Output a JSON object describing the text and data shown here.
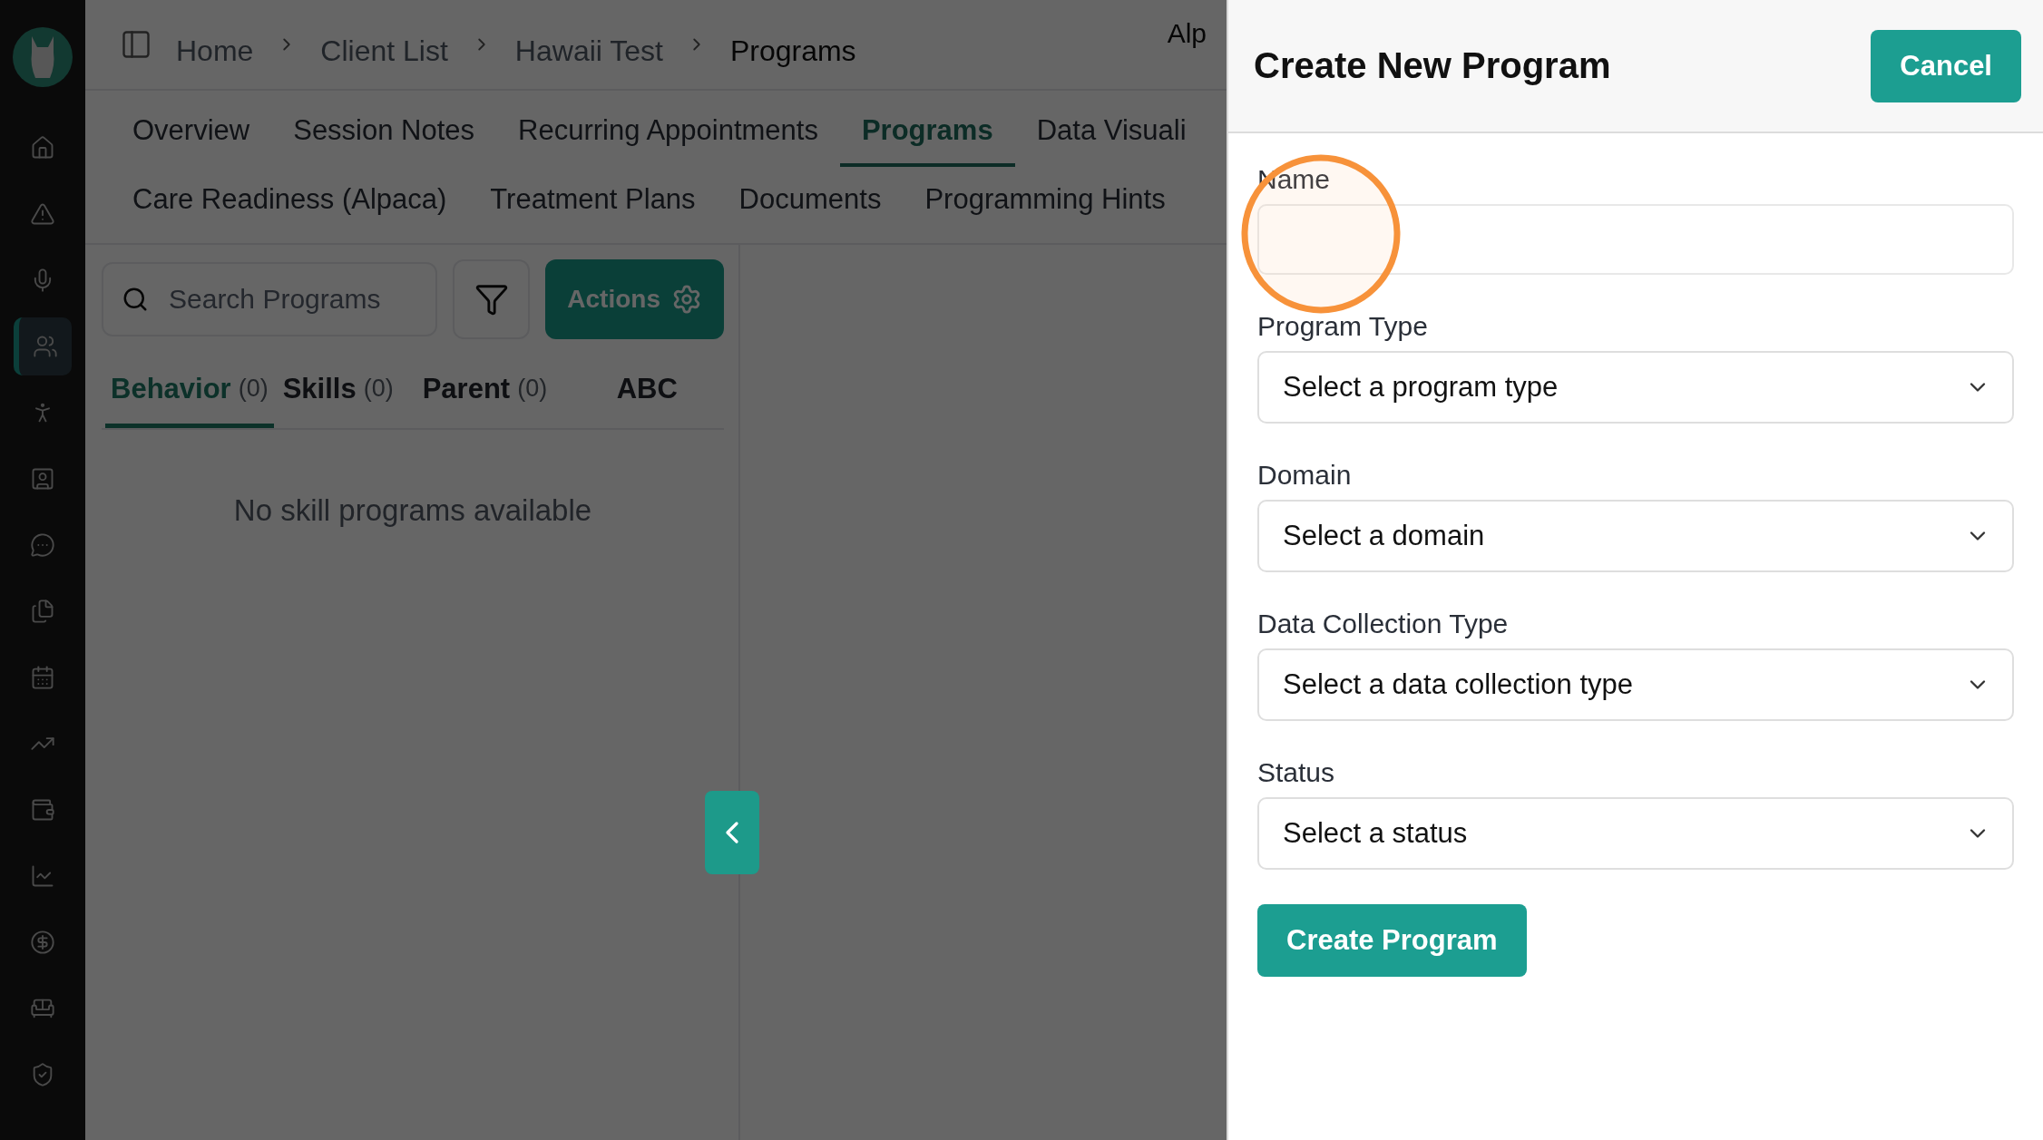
{
  "sidebar": {
    "items": [
      {
        "selected": false
      },
      {
        "selected": false
      },
      {
        "selected": false
      },
      {
        "selected": true
      },
      {
        "selected": false
      },
      {
        "selected": false
      },
      {
        "selected": false
      },
      {
        "selected": false
      },
      {
        "selected": false
      },
      {
        "selected": false
      },
      {
        "selected": false
      },
      {
        "selected": false
      },
      {
        "selected": false
      },
      {
        "selected": false
      },
      {
        "selected": false
      }
    ]
  },
  "breadcrumb": [
    "Home",
    "Client List",
    "Hawaii Test",
    "Programs"
  ],
  "header_text": "Alp",
  "tab_rows": [
    [
      {
        "label": "Overview",
        "selected": false
      },
      {
        "label": "Session Notes",
        "selected": false
      },
      {
        "label": "Recurring Appointments",
        "selected": false
      },
      {
        "label": "Programs",
        "selected": true
      },
      {
        "label": "Data Visuali",
        "selected": false
      }
    ],
    [
      {
        "label": "Care Readiness (Alpaca)",
        "selected": false
      },
      {
        "label": "Treatment Plans",
        "selected": false
      },
      {
        "label": "Documents",
        "selected": false
      },
      {
        "label": "Programming Hints",
        "selected": false
      }
    ]
  ],
  "search": {
    "placeholder": "Search Programs"
  },
  "actions_button": "Actions",
  "program_tabs": [
    {
      "label": "Behavior",
      "count": "(0)",
      "selected": true
    },
    {
      "label": "Skills",
      "count": "(0)",
      "selected": false
    },
    {
      "label": "Parent",
      "count": "(0)",
      "selected": false
    },
    {
      "label": "ABC",
      "selected": false
    }
  ],
  "empty_message": "No skill programs available",
  "drawer": {
    "title": "Create New Program",
    "cancel": "Cancel",
    "fields": [
      {
        "kind": "text",
        "label": "Name"
      },
      {
        "kind": "select",
        "label": "Program Type",
        "placeholder": "Select a program type"
      },
      {
        "kind": "select",
        "label": "Domain",
        "placeholder": "Select a domain"
      },
      {
        "kind": "select",
        "label": "Data Collection Type",
        "placeholder": "Select a data collection type"
      },
      {
        "kind": "select",
        "label": "Status",
        "placeholder": "Select a status"
      }
    ],
    "submit": "Create Program"
  }
}
